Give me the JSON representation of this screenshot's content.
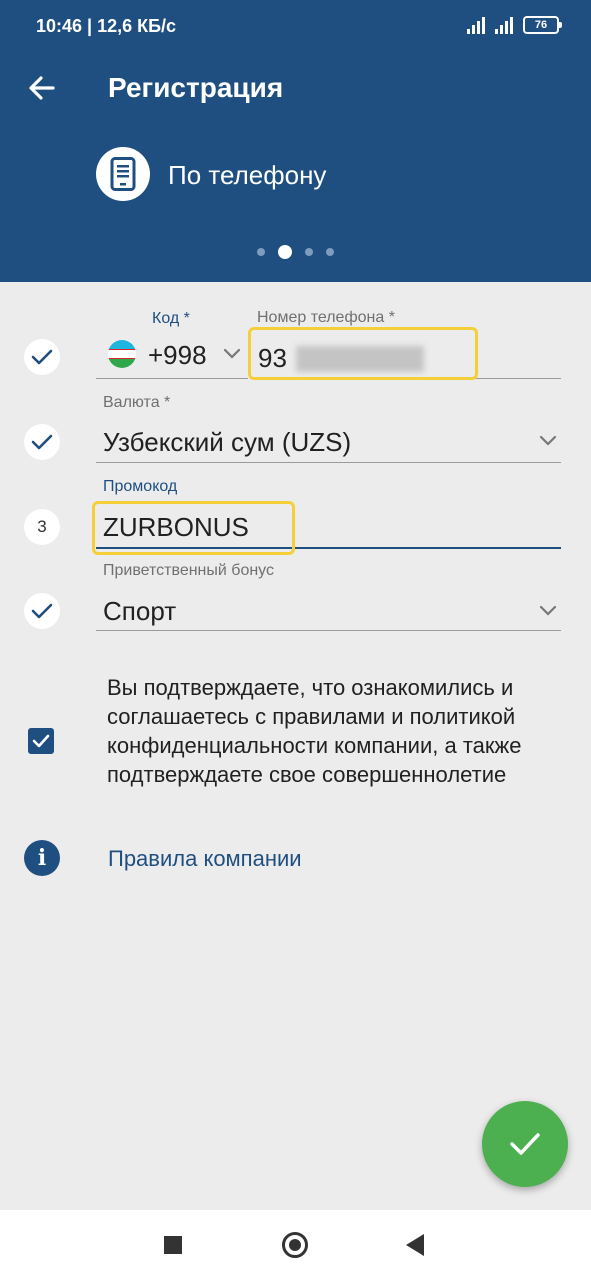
{
  "status_bar": {
    "time_speed": "10:46 | 12,6 КБ/с",
    "battery": "76"
  },
  "app_bar": {
    "title": "Регистрация",
    "method_label": "По телефону",
    "method_icon": "phone-icon",
    "pager": {
      "total": 4,
      "active": 2
    }
  },
  "form": {
    "code": {
      "label": "Код *",
      "value": "+998",
      "flag": "uzbekistan-flag"
    },
    "phone": {
      "label": "Номер телефона *",
      "value": "93"
    },
    "currency": {
      "label": "Валюта *",
      "value": "Узбекский сум (UZS)"
    },
    "promo": {
      "label": "Промокод",
      "value": "ZURBONUS",
      "step": "3"
    },
    "bonus": {
      "label": "Приветственный бонус",
      "value": "Спорт"
    }
  },
  "consent": {
    "checked": true,
    "text": "Вы подтверждаете, что ознакомились и соглашаетесь с правилами и политикой конфиденциальности компании, а также подтверждаете свое совершеннолетие"
  },
  "rules_link": "Правила компании",
  "colors": {
    "primary": "#1f4f80",
    "background": "#ececec",
    "fab": "#4caf50",
    "highlight": "#f5cf3a"
  }
}
